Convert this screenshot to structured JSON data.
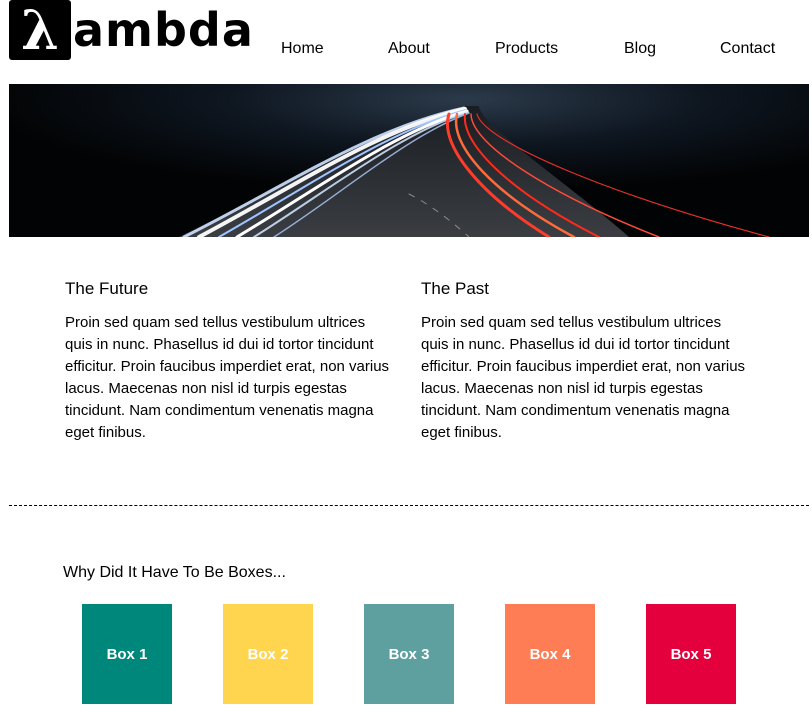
{
  "logo": {
    "mark": "λ",
    "text": "ambda"
  },
  "nav": {
    "items": [
      "Home",
      "About",
      "Products",
      "Blog",
      "Contact"
    ]
  },
  "hero": {
    "image": "night-highway-light-trails"
  },
  "sections": [
    {
      "title": "The Future",
      "body": "Proin sed quam sed tellus vestibulum ultrices quis in nunc. Phasellus id dui id tortor tincidunt efficitur. Proin faucibus imperdiet erat, non varius lacus. Maecenas non nisl id turpis egestas tincidunt. Nam condimentum venenatis magna eget finibus."
    },
    {
      "title": "The Past",
      "body": "Proin sed quam sed tellus vestibulum ultrices quis in nunc. Phasellus id dui id tortor tincidunt efficitur. Proin faucibus imperdiet erat, non varius lacus. Maecenas non nisl id turpis egestas tincidunt. Nam condimentum venenatis magna eget finibus."
    }
  ],
  "boxes": {
    "title": "Why Did It Have To Be Boxes...",
    "items": [
      {
        "label": "Box 1",
        "color": "#00877c"
      },
      {
        "label": "Box 2",
        "color": "#ffd54f"
      },
      {
        "label": "Box 3",
        "color": "#5e9f9f"
      },
      {
        "label": "Box 4",
        "color": "#ff7d55"
      },
      {
        "label": "Box 5",
        "color": "#e3003d"
      }
    ]
  }
}
